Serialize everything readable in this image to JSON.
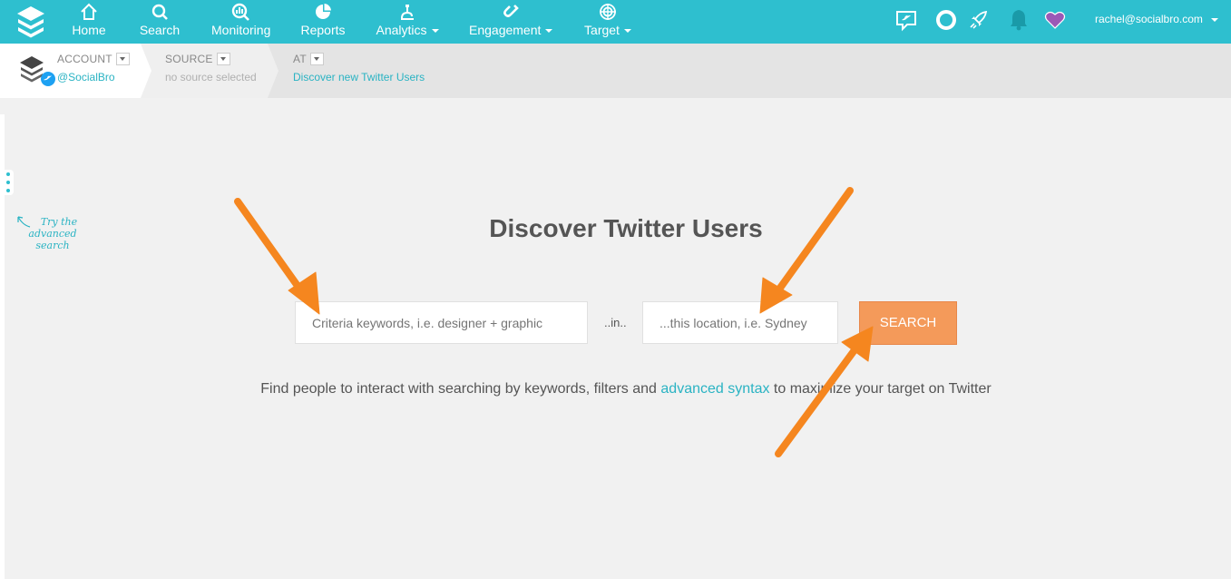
{
  "nav": {
    "items": [
      {
        "label": "Home",
        "icon": "home-icon"
      },
      {
        "label": "Search",
        "icon": "search-icon"
      },
      {
        "label": "Monitoring",
        "icon": "monitoring-icon"
      },
      {
        "label": "Reports",
        "icon": "pie-chart-icon"
      },
      {
        "label": "Analytics",
        "icon": "microscope-icon"
      },
      {
        "label": "Engagement",
        "icon": "magnet-icon"
      },
      {
        "label": "Target",
        "icon": "target-icon"
      }
    ],
    "user_email": "rachel@socialbro.com"
  },
  "breadcrumb": {
    "account_title": "ACCOUNT",
    "account_value": "@SocialBro",
    "source_title": "SOURCE",
    "source_value": "no source selected",
    "at_title": "AT",
    "at_value": "Discover new Twitter Users"
  },
  "hint": {
    "line1": "Try the",
    "line2": "advanced",
    "line3": "search"
  },
  "main": {
    "title": "Discover Twitter Users",
    "keywords_placeholder": "Criteria keywords, i.e. designer + graphic",
    "in_text": "..in..",
    "location_placeholder": "...this location, i.e. Sydney",
    "search_label": "SEARCH",
    "desc_before": "Find people to interact with searching by keywords, filters and ",
    "desc_link": "advanced syntax",
    "desc_after": " to maximize your target on Twitter"
  },
  "colors": {
    "brand": "#2ebfcf",
    "button": "#f49a5a",
    "annotation_arrow": "#f5861f",
    "heart": "#9b59b6",
    "bell": "#1a9aa8"
  }
}
